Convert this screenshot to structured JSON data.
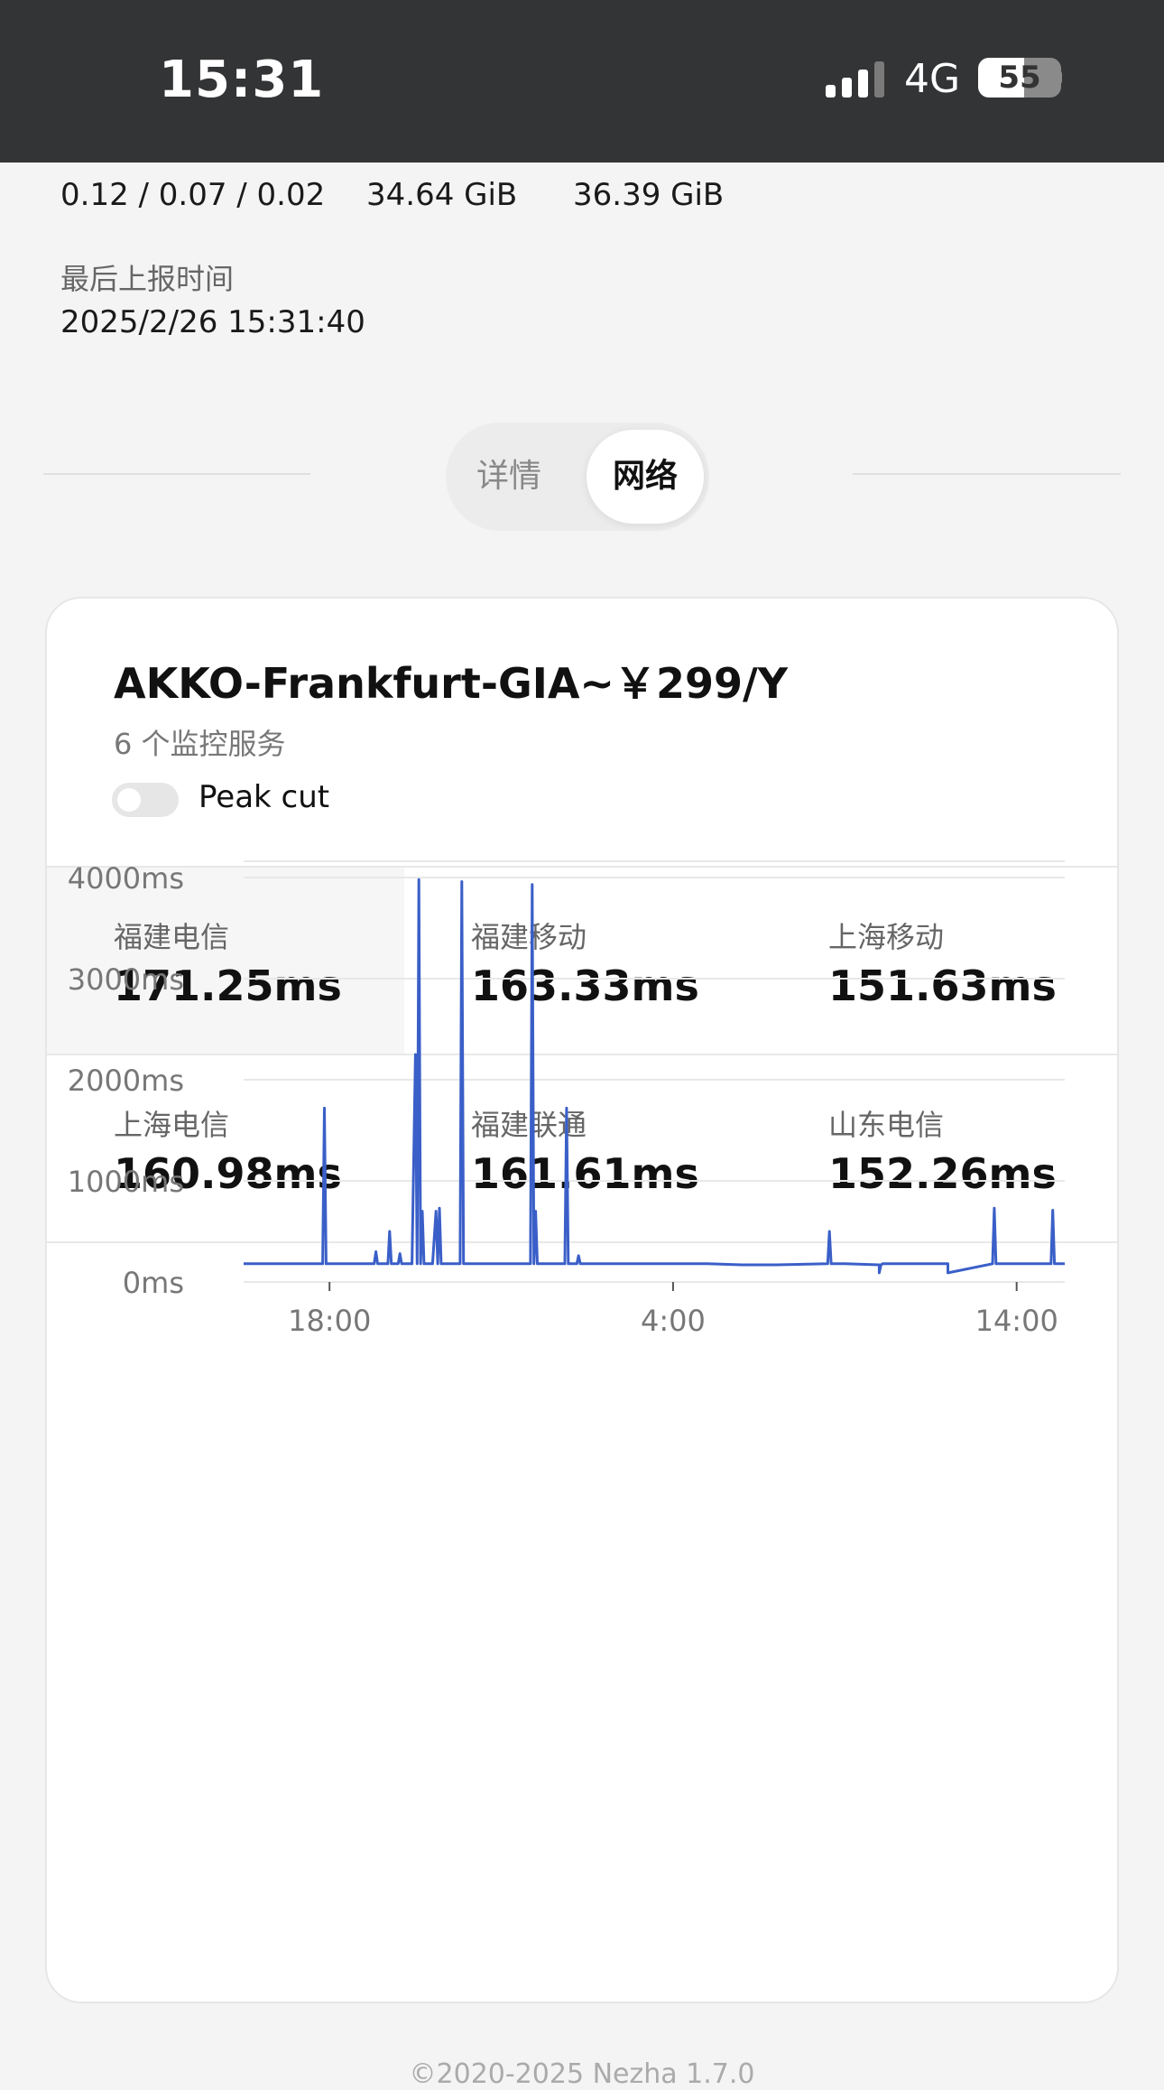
{
  "status_bar": {
    "time": "15:31",
    "network": "4G",
    "battery": "55",
    "battery_level": 0.55,
    "signal_bars": 3
  },
  "summary": {
    "load": "0.12 / 0.07 / 0.02",
    "value_2": "34.64 GiB",
    "value_3": "36.39 GiB",
    "last_report_label": "最后上报时间",
    "last_report_value": "2025/2/26 15:31:40"
  },
  "tabs": {
    "details": "详情",
    "network": "网络",
    "active": "network"
  },
  "card": {
    "title": "AKKO-Frankfurt-GIA~￥299/Y",
    "subtitle": "6 个监控服务",
    "peak_cut_label": "Peak cut",
    "peak_cut_on": false,
    "stats": [
      {
        "label": "福建电信",
        "value": "171.25ms"
      },
      {
        "label": "福建移动",
        "value": "163.33ms"
      },
      {
        "label": "上海移动",
        "value": "151.63ms"
      },
      {
        "label": "上海电信",
        "value": "160.98ms"
      },
      {
        "label": "福建联通",
        "value": "161.61ms"
      },
      {
        "label": "山东电信",
        "value": "152.26ms"
      }
    ]
  },
  "colors": {
    "line": "#3a5fc8",
    "grid": "#e8e8e8"
  },
  "chart_data": {
    "type": "line",
    "y_tick_labels": [
      "0ms",
      "1000ms",
      "2000ms",
      "3000ms",
      "4000ms"
    ],
    "y_ticks": [
      0,
      1000,
      2000,
      3000,
      4000
    ],
    "ylim": [
      0,
      4000
    ],
    "x_tick_labels": [
      "18:00",
      "4:00",
      "14:00"
    ],
    "x_ticks": [
      18,
      28,
      38
    ],
    "xlim": [
      15.5,
      39.4
    ],
    "grid": true,
    "series": [
      {
        "x": [
          15.5,
          17.8,
          17.85,
          17.9,
          18.3,
          18.9,
          19.3,
          19.35,
          19.4,
          19.7,
          19.75,
          19.8,
          20.0,
          20.05,
          20.1,
          20.4,
          20.5,
          20.55,
          20.6,
          20.65,
          20.7,
          20.75,
          20.8,
          21.0,
          21.1,
          21.15,
          21.2,
          21.25,
          21.3,
          21.8,
          21.85,
          21.9,
          22.7,
          23.3,
          23.85,
          23.9,
          23.95,
          24.0,
          24.05,
          24.1,
          24.85,
          24.9,
          24.95,
          25.2,
          25.25,
          25.3,
          26.0,
          29.0,
          30.0,
          31.0,
          32.5,
          32.55,
          32.6,
          33.0,
          34.0,
          34.0,
          34.05,
          34.1,
          36.0,
          36.0,
          37.3,
          37.35,
          37.4,
          38.0,
          39.0,
          39.05,
          39.1,
          39.4
        ],
        "y": [
          180,
          180,
          1720,
          180,
          180,
          180,
          180,
          300,
          180,
          180,
          500,
          180,
          180,
          280,
          180,
          180,
          2250,
          180,
          3980,
          180,
          700,
          180,
          180,
          180,
          700,
          180,
          730,
          180,
          180,
          180,
          3960,
          180,
          180,
          180,
          180,
          3930,
          180,
          700,
          180,
          180,
          180,
          1720,
          180,
          180,
          260,
          180,
          180,
          180,
          170,
          170,
          180,
          500,
          180,
          180,
          170,
          90,
          170,
          180,
          180,
          90,
          180,
          730,
          180,
          180,
          180,
          710,
          180,
          180
        ]
      }
    ]
  },
  "footer": "©2020-2025 Nezha 1.7.0"
}
